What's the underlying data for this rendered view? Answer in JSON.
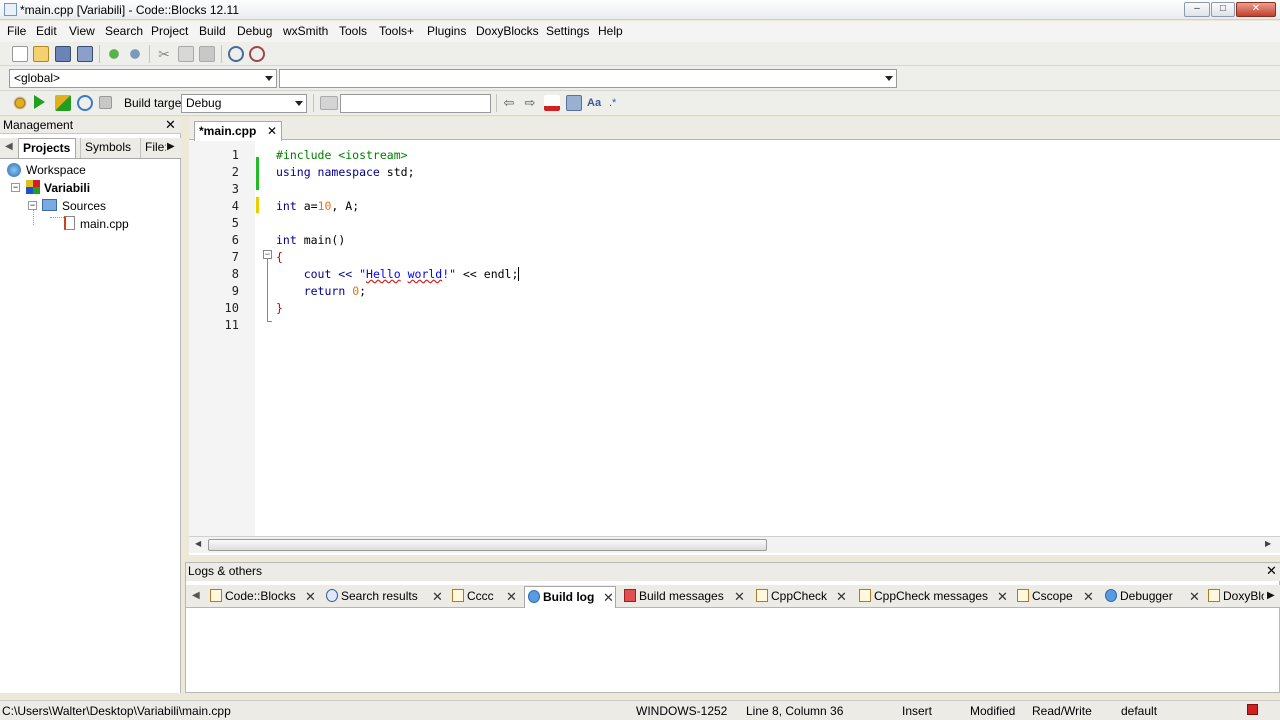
{
  "window": {
    "title": "*main.cpp [Variabili] - Code::Blocks 12.11",
    "minimize": "–",
    "maximize": "□",
    "close": "✕"
  },
  "menu": [
    "File",
    "Edit",
    "View",
    "Search",
    "Project",
    "Build",
    "Debug",
    "wxSmith",
    "Tools",
    "Tools+",
    "Plugins",
    "DoxyBlocks",
    "Settings",
    "Help"
  ],
  "scope": {
    "value": "<global>",
    "function_value": ""
  },
  "build": {
    "label": "Build target:",
    "target": "Debug",
    "search_value": ""
  },
  "icons": [
    "new-file-icon",
    "open-icon",
    "save-icon",
    "save-all-icon",
    "undo-icon",
    "redo-icon",
    "cut-icon",
    "copy-icon",
    "paste-icon",
    "find-icon",
    "replace-icon",
    "build-icon",
    "run-icon",
    "build-run-icon",
    "rebuild-icon",
    "abort-icon"
  ],
  "management": {
    "title": "Management",
    "close": "✕",
    "tabs": [
      "Projects",
      "Symbols",
      "File:"
    ],
    "tree": {
      "workspace": "Workspace",
      "project": "Variabili",
      "folder": "Sources",
      "file": "main.cpp"
    }
  },
  "editor": {
    "tab": "*main.cpp",
    "tab_close": "✕",
    "line_numbers": [
      "1",
      "2",
      "3",
      "4",
      "5",
      "6",
      "7",
      "8",
      "9",
      "10",
      "11"
    ],
    "lines": {
      "l1": "#include <iostream>",
      "l2a": "using",
      "l2b": " namespace",
      "l2c": " std;",
      "l4a": "int",
      "l4b": " a=",
      "l4c": "10",
      "l4d": ", A;",
      "l6a": "int",
      "l6b": " main()",
      "l7": "{",
      "l8a": "    cout << ",
      "l8b": "\"",
      "l8c": "Hello",
      "l8d": " ",
      "l8e": "world",
      "l8f": "!\"",
      "l8g": " << endl;",
      "l9a": "    ",
      "l9b": "return",
      "l9c": " ",
      "l9d": "0",
      "l9e": ";",
      "l10": "}"
    }
  },
  "logs": {
    "title": "Logs & others",
    "close": "✕",
    "tabs": [
      {
        "label": "Code::Blocks",
        "close": "✕"
      },
      {
        "label": "Search results",
        "close": "✕"
      },
      {
        "label": "Cccc",
        "close": "✕"
      },
      {
        "label": "Build log",
        "close": "✕"
      },
      {
        "label": "Build messages",
        "close": "✕"
      },
      {
        "label": "CppCheck",
        "close": "✕"
      },
      {
        "label": "CppCheck messages",
        "close": "✕"
      },
      {
        "label": "Cscope",
        "close": "✕"
      },
      {
        "label": "Debugger",
        "close": "✕"
      },
      {
        "label": "DoxyBlo",
        "close": ""
      }
    ]
  },
  "status": {
    "path": "C:\\Users\\Walter\\Desktop\\Variabili\\main.cpp",
    "encoding": "WINDOWS-1252",
    "position": "Line 8, Column 36",
    "mode": "Insert",
    "modified": "Modified",
    "access": "Read/Write",
    "profile": "default"
  },
  "colors": {
    "keyword": "#00008b",
    "string": "#0000ff",
    "number": "#f07010",
    "preprocessor": "#008000",
    "change_saved": "#22bb22",
    "change_unsaved": "#e8d000"
  }
}
